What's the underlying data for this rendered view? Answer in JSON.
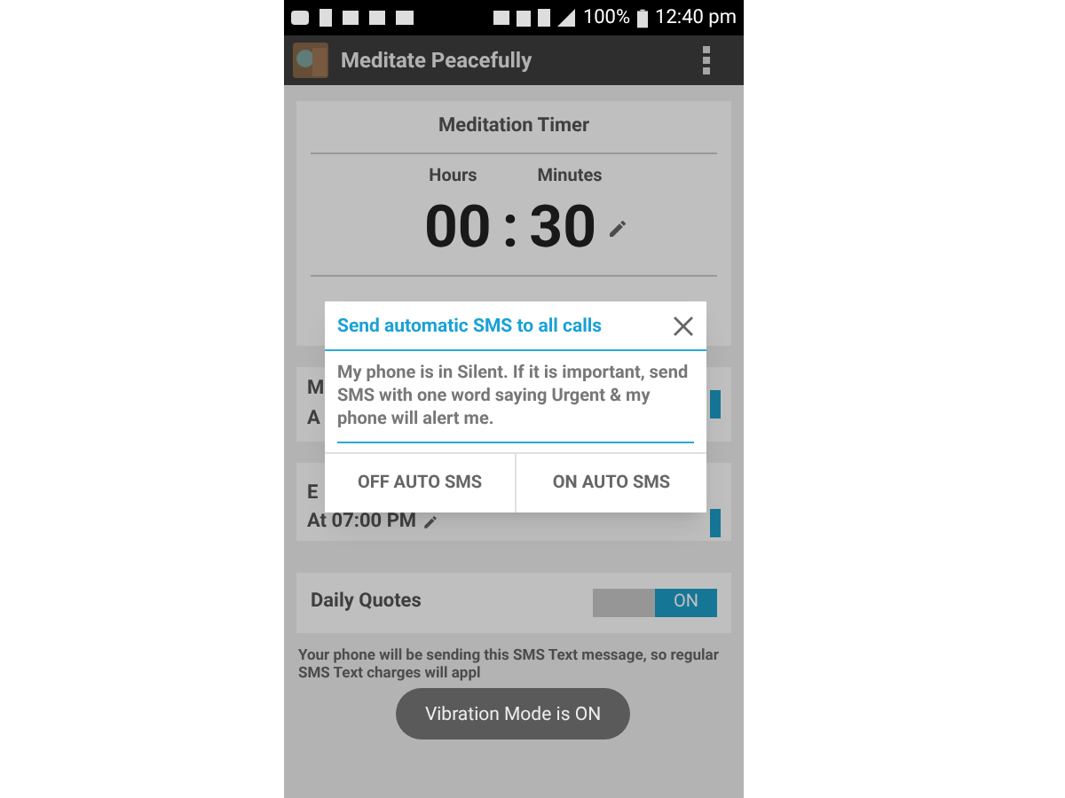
{
  "status_bar": {
    "battery": "100%",
    "time": "12:40 pm"
  },
  "app_bar": {
    "title": "Meditate Peacefully"
  },
  "timer": {
    "title": "Meditation Timer",
    "hours_label": "Hours",
    "minutes_label": "Minutes",
    "hours": "00",
    "separator": ":",
    "minutes": "30"
  },
  "settings": [
    {
      "title": "M",
      "subtitle": "A",
      "on": true
    },
    {
      "title": "E",
      "subtitle": "At 07:00 PM",
      "on": true
    },
    {
      "title": "Daily Quotes",
      "toggle_label": "ON",
      "on": true
    }
  ],
  "footnote": "Your phone will be sending this SMS Text message, so regular SMS Text charges will appl",
  "dialog": {
    "title": "Send automatic SMS to all calls",
    "message": "My phone is in Silent. If it is important, send SMS with one word saying Urgent & my phone will alert me.",
    "buttons": [
      "OFF AUTO SMS",
      "ON AUTO SMS"
    ]
  },
  "toast": "Vibration Mode is ON"
}
